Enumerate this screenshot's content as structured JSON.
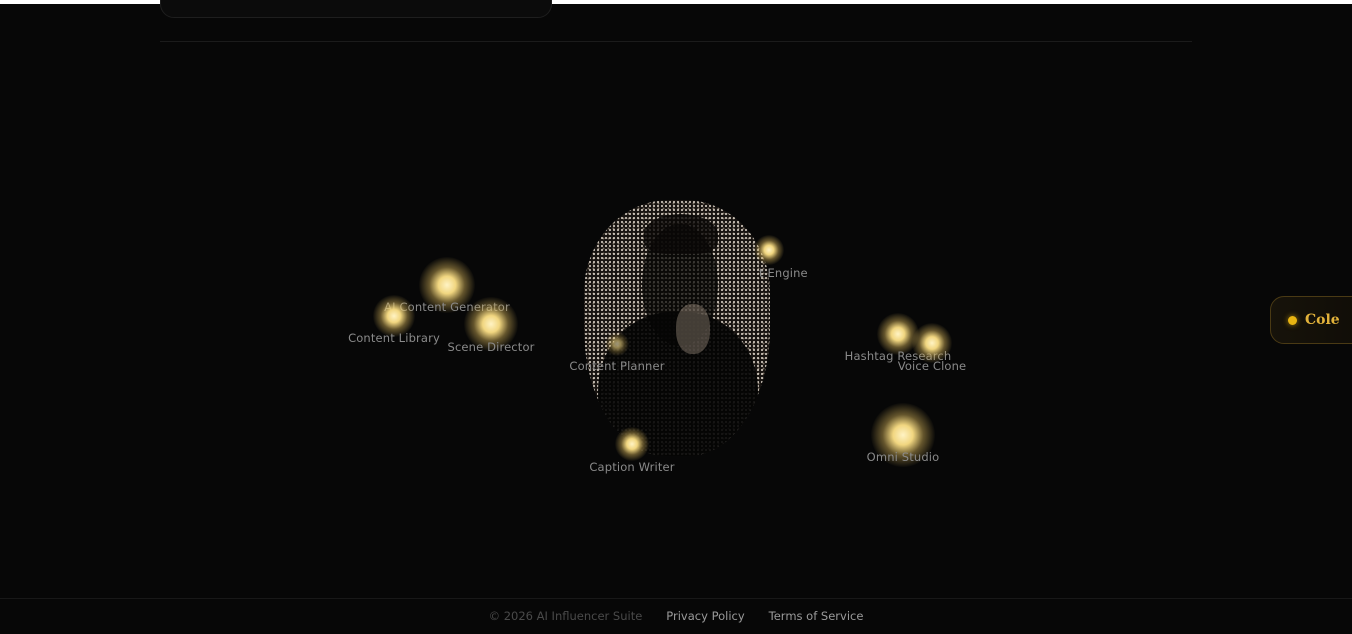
{
  "assistant": {
    "name": "Cole"
  },
  "nodes": [
    {
      "id": "ai-content-generator",
      "label": "AI Content Generator"
    },
    {
      "id": "content-library",
      "label": "Content Library"
    },
    {
      "id": "scene-director",
      "label": "Scene Director"
    },
    {
      "id": "content-planner",
      "label": "Content Planner"
    },
    {
      "id": "script-engine",
      "label": "t Engine"
    },
    {
      "id": "hashtag-research",
      "label": "Hashtag Research"
    },
    {
      "id": "voice-clone",
      "label": "Voice Clone"
    },
    {
      "id": "caption-writer",
      "label": "Caption Writer"
    },
    {
      "id": "omni-studio",
      "label": "Omni Studio"
    }
  ],
  "footer": {
    "copyright": "© 2026 AI Influencer Suite",
    "privacy": "Privacy Policy",
    "terms": "Terms of Service"
  },
  "colors": {
    "accent": "#e8b412",
    "background": "#070707",
    "orb": "#f1d680"
  }
}
